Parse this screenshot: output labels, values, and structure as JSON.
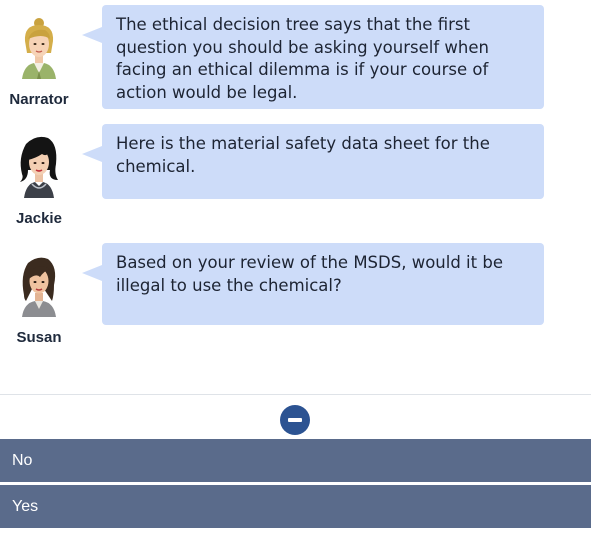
{
  "conversation": {
    "messages": [
      {
        "speaker": "Narrator",
        "text": "The ethical decision tree says that the first question you should be asking yourself when facing an ethical dilemma is if your course of action would be legal."
      },
      {
        "speaker": "Jackie",
        "text": "Here is the material safety data sheet for the chemical."
      },
      {
        "speaker": "Susan",
        "text": "Based on your review of the MSDS, would it be illegal to use the chemical?"
      }
    ]
  },
  "choices": [
    {
      "label": "No"
    },
    {
      "label": "Yes"
    }
  ],
  "colors": {
    "bubble": "#cddcf9",
    "choice_bg": "#5a6b8b",
    "collapse_button": "#2c5392",
    "text": "#1d2433"
  },
  "icons": {
    "collapse": "minus-circle-icon"
  }
}
